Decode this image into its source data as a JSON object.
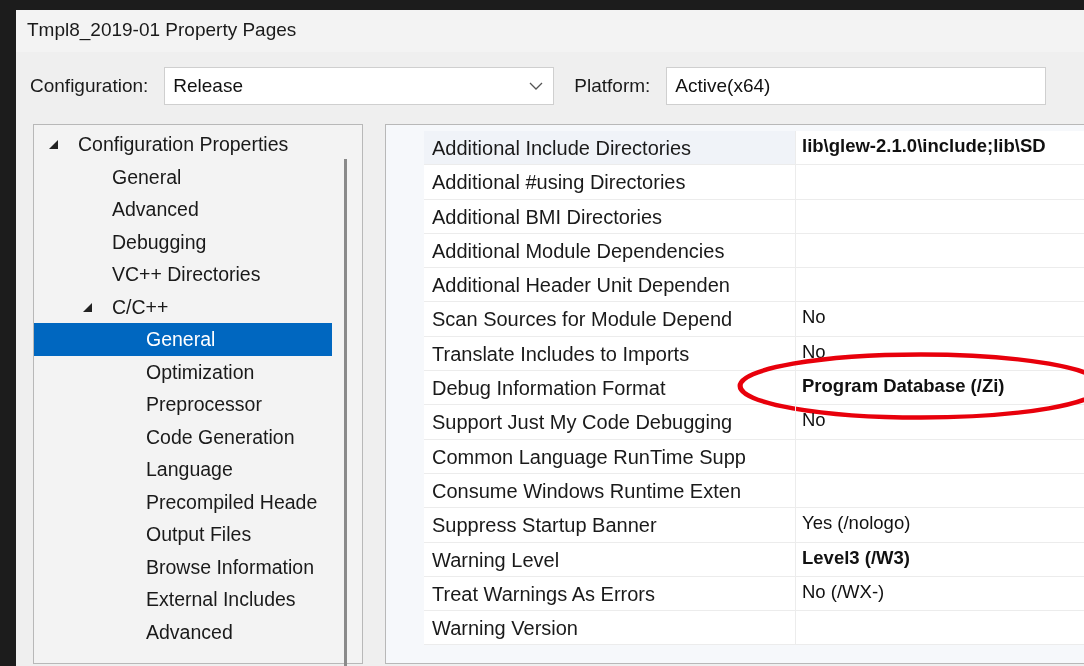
{
  "window": {
    "title": "Tmpl8_2019-01 Property Pages"
  },
  "configuration": {
    "label": "Configuration:",
    "value": "Release"
  },
  "platform": {
    "label": "Platform:",
    "value": "Active(x64)"
  },
  "tree": [
    {
      "label": "Configuration Properties",
      "expanded": true,
      "selected": false,
      "children": [
        {
          "label": "General",
          "selected": false
        },
        {
          "label": "Advanced",
          "selected": false
        },
        {
          "label": "Debugging",
          "selected": false
        },
        {
          "label": "VC++ Directories",
          "selected": false
        },
        {
          "label": "C/C++",
          "expanded": true,
          "selected": false,
          "children": [
            {
              "label": "General",
              "selected": true
            },
            {
              "label": "Optimization",
              "selected": false
            },
            {
              "label": "Preprocessor",
              "selected": false
            },
            {
              "label": "Code Generation",
              "selected": false
            },
            {
              "label": "Language",
              "selected": false
            },
            {
              "label": "Precompiled Heade",
              "selected": false
            },
            {
              "label": "Output Files",
              "selected": false
            },
            {
              "label": "Browse Information",
              "selected": false
            },
            {
              "label": "External Includes",
              "selected": false
            },
            {
              "label": "Advanced",
              "selected": false
            }
          ]
        }
      ]
    }
  ],
  "properties": [
    {
      "name": "Additional Include Directories",
      "value": "lib\\glew-2.1.0\\include;lib\\SD",
      "bold": true,
      "selected": true
    },
    {
      "name": "Additional #using Directories",
      "selected": false
    },
    {
      "name": "Additional BMI Directories",
      "selected": false
    },
    {
      "name": "Additional Module Dependencies",
      "selected": false
    },
    {
      "name": "Additional Header Unit Dependen",
      "selected": false
    },
    {
      "name": "Scan Sources for Module Depend",
      "value": "No",
      "bold": false,
      "selected": false
    },
    {
      "name": "Translate Includes to Imports",
      "value": "No",
      "bold": false,
      "selected": false
    },
    {
      "name": "Debug Information Format",
      "value": "Program Database (/Zi)",
      "bold": true,
      "selected": false,
      "circled": true
    },
    {
      "name": "Support Just My Code Debugging",
      "value": "No",
      "bold": false,
      "selected": false
    },
    {
      "name": "Common Language RunTime Supp",
      "selected": false
    },
    {
      "name": "Consume Windows Runtime Exten",
      "selected": false
    },
    {
      "name": "Suppress Startup Banner",
      "value": "Yes (/nologo)",
      "bold": false,
      "selected": false
    },
    {
      "name": "Warning Level",
      "value": "Level3 (/W3)",
      "bold": true,
      "selected": false
    },
    {
      "name": "Treat Warnings As Errors",
      "value": "No (/WX-)",
      "bold": false,
      "selected": false
    },
    {
      "name": "Warning Version",
      "selected": false
    }
  ]
}
